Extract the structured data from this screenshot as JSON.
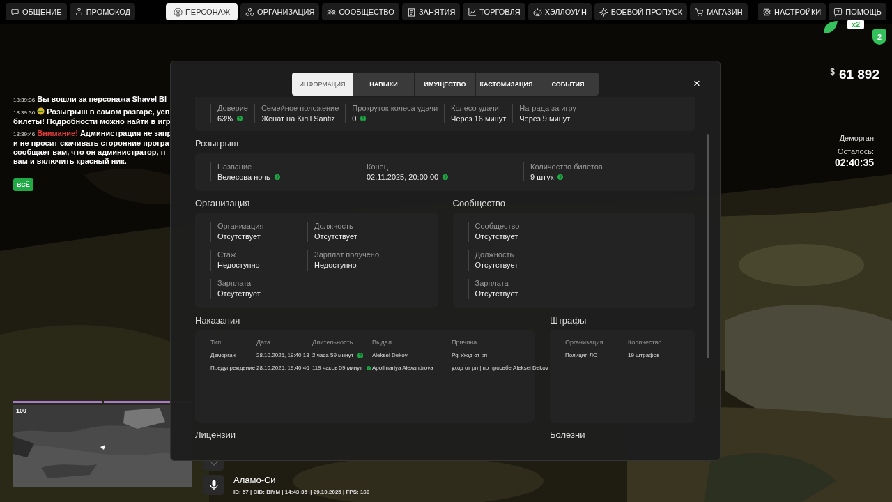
{
  "top_menu": {
    "left": [
      {
        "label": "ОБЩЕНИЕ",
        "selected": false
      },
      {
        "label": "ПРОМОКОД",
        "selected": false
      }
    ],
    "center": [
      {
        "label": "ПЕРСОНАЖ",
        "selected": true
      },
      {
        "label": "ОРГАНИЗАЦИЯ",
        "selected": false
      },
      {
        "label": "СООБЩЕСТВО",
        "selected": false
      },
      {
        "label": "ЗАНЯТИЯ",
        "selected": false
      },
      {
        "label": "ТОРГОВЛЯ",
        "selected": false
      },
      {
        "label": "ХЭЛЛОУИН",
        "selected": false
      },
      {
        "label": "БОЕВОЙ ПРОПУСК",
        "selected": false
      },
      {
        "label": "МАГАЗИН",
        "selected": false
      }
    ],
    "right": [
      {
        "label": "НАСТРОЙКИ",
        "selected": false
      },
      {
        "label": "ПОМОЩЬ",
        "selected": false
      }
    ]
  },
  "badges": [
    {
      "text": "x2"
    },
    {
      "text": "2"
    }
  ],
  "money": {
    "currency": "$",
    "amount": "61 892"
  },
  "timer": {
    "title": "Деморган",
    "label": "Осталось:",
    "time": "02:40:35"
  },
  "chat": {
    "messages": [
      {
        "time": "18:39:36",
        "lines": [
          "Вы вошли за персонажа Shavel Bl"
        ]
      },
      {
        "time": "18:39:36",
        "icon": true,
        "lines": [
          "Розыгрыш в самом разгаре, усп",
          "билеты! Подробности можно найти в игр"
        ]
      },
      {
        "time": "18:39:46",
        "alert": "Внимание!",
        "lines": [
          "Администрация не запр",
          "и не просит скачивать сторонние програ",
          "сообщает вам, что он администратор, п",
          "вам и включить красный ник."
        ]
      }
    ],
    "filter_button": "ВСЁ"
  },
  "window": {
    "tabs": [
      {
        "label": "ИНФОРМАЦИЯ",
        "selected": true
      },
      {
        "label": "НАВЫКИ",
        "selected": false
      },
      {
        "label": "ИМУЩЕСТВО",
        "selected": false
      },
      {
        "label": "КАСТОМИЗАЦИЯ",
        "selected": false
      },
      {
        "label": "СОБЫТИЯ",
        "selected": false
      }
    ],
    "close": "×",
    "info": {
      "fields": [
        {
          "label": "Доверие",
          "value": "63%",
          "help": true
        },
        {
          "label": "Семейное положение",
          "value": "Женат на Kirill Santiz"
        },
        {
          "label": "Прокруток колеса удачи",
          "value": "0",
          "help": true
        },
        {
          "label": "Колесо удачи",
          "value": "Через 16 минут"
        },
        {
          "label": "Награда за игру",
          "value": "Через 9 минут"
        }
      ]
    },
    "raffle": {
      "title": "Розыгрыш",
      "fields": [
        {
          "label": "Название",
          "value": "Велесова ночь",
          "help": true
        },
        {
          "label": "Конец",
          "value": "02.11.2025, 20:00:00",
          "help": true
        },
        {
          "label": "Количество билетов",
          "value": "9 штук",
          "help": true
        }
      ]
    },
    "organization": {
      "title": "Организация",
      "fields": [
        {
          "label": "Организация",
          "value": "Отсутствует"
        },
        {
          "label": "Должность",
          "value": "Отсутствует"
        },
        {
          "label": "Стаж",
          "value": "Недоступно"
        },
        {
          "label": "Зарплат получено",
          "value": "Недоступно"
        },
        {
          "label": "Зарплата",
          "value": "Отсутствует"
        }
      ]
    },
    "community": {
      "title": "Сообщество",
      "fields": [
        {
          "label": "Сообщество",
          "value": "Отсутствует"
        },
        {
          "label": "Должность",
          "value": "Отсутствует"
        },
        {
          "label": "Зарплата",
          "value": "Отсутствует"
        }
      ]
    },
    "punishments": {
      "title": "Наказания",
      "columns": [
        "Тип",
        "Дата",
        "Длительность",
        "Выдал",
        "Причина"
      ],
      "rows": [
        {
          "cells": [
            "Деморган",
            "28.10.2025, 19:40:13",
            "2 часа 59 минут",
            "Aleksei Dekov",
            "Pg-Уход от рп"
          ],
          "help": true
        },
        {
          "cells": [
            "Предупреждение",
            "28.10.2025, 19:40:46",
            "119 часов 59 минут",
            "Apollinariya Alexandrova",
            "уход от рп | по просьбе Aleksei Dekov"
          ],
          "help": true
        }
      ]
    },
    "fines": {
      "title": "Штрафы",
      "columns": [
        "Организация",
        "Количество"
      ],
      "rows": [
        {
          "cells": [
            "Полиция ЛС",
            "19 штрафов"
          ]
        }
      ]
    },
    "licenses": {
      "title": "Лицензии"
    },
    "diseases": {
      "title": "Болезни"
    }
  },
  "minimap": {
    "bars": [
      {
        "level": 1
      },
      {
        "level": 1
      }
    ],
    "health": "100"
  },
  "status": {
    "location": "Аламо-Си",
    "info": "ID: 57 | CID: BIYM | 14:43:35  | 29.10.2025 | FPS: 166"
  }
}
